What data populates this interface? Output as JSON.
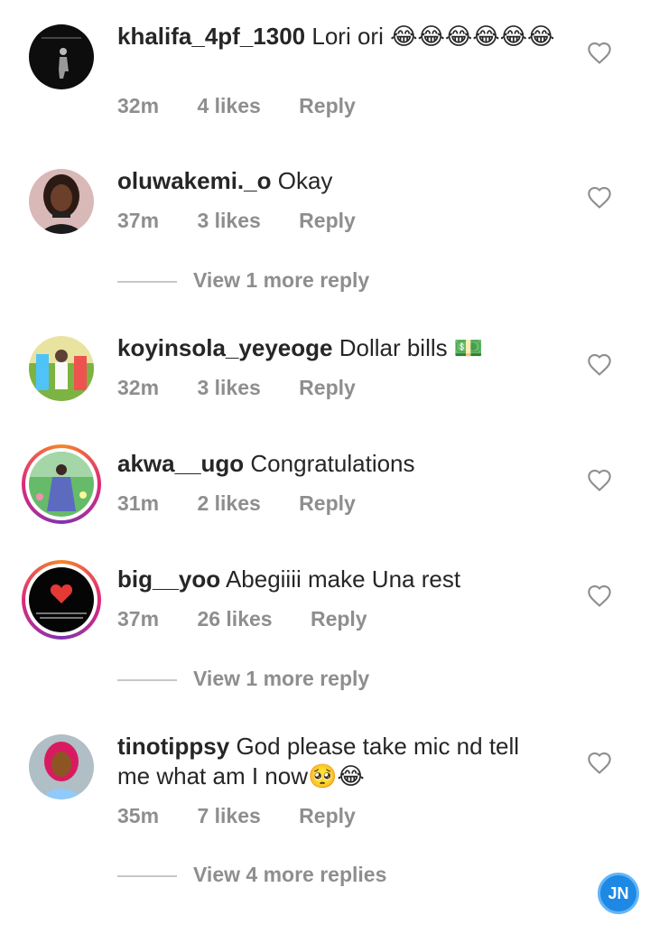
{
  "comments": [
    {
      "username": "khalifa_4pf_1300",
      "text": "Lori ori",
      "emojis": "😂😂😂😂😂😂",
      "time": "32m",
      "likes": "4 likes",
      "reply": "Reply",
      "avatar_icon": "dark-portrait-avatar"
    },
    {
      "username": "oluwakemi._o",
      "text": "Okay",
      "emojis": "",
      "time": "37m",
      "likes": "3 likes",
      "reply": "Reply",
      "avatar_icon": "woman-portrait-avatar"
    },
    {
      "username": "koyinsola_yeyeoge",
      "text": "Dollar bills",
      "emojis": "💵",
      "time": "32m",
      "likes": "3 likes",
      "reply": "Reply",
      "avatar_icon": "colorful-portrait-avatar"
    },
    {
      "username": "akwa__ugo",
      "text": "Congratulations",
      "emojis": "",
      "time": "31m",
      "likes": "2 likes",
      "reply": "Reply",
      "avatar_icon": "garden-portrait-avatar"
    },
    {
      "username": "big__yoo",
      "text": "Abegiiii make Una rest",
      "emojis": "",
      "time": "37m",
      "likes": "26 likes",
      "reply": "Reply",
      "avatar_icon": "red-heart-avatar"
    },
    {
      "username": "tinotippsy",
      "text": "God please take mic nd tell me what am I now",
      "emojis": "🥺😂",
      "time": "35m",
      "likes": "7 likes",
      "reply": "Reply",
      "avatar_icon": "pink-hair-portrait-avatar"
    }
  ],
  "view_more": [
    "View 1 more reply",
    "View 1 more reply",
    "View 4 more replies"
  ],
  "watermark": "JN",
  "colors": {
    "text": "#262626",
    "muted": "#8e8e8e",
    "divider": "#c7c7c7",
    "story_ring_start": "#f58529",
    "story_ring_end": "#dd2a7b"
  }
}
